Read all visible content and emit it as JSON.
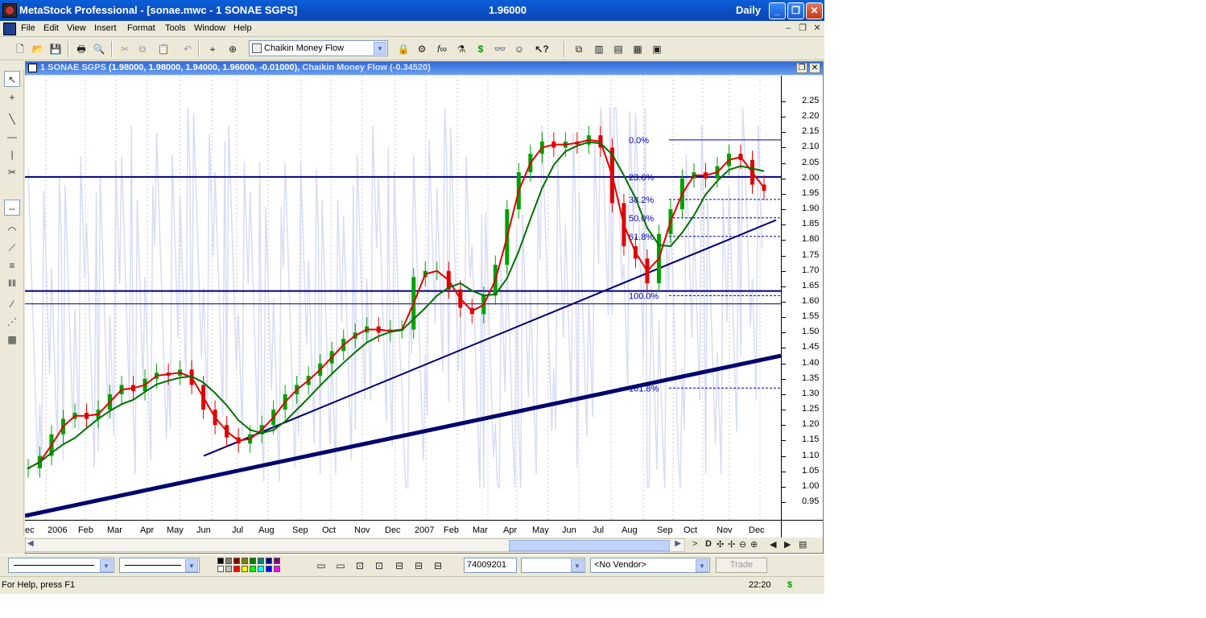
{
  "window": {
    "title": "MetaStock Professional - [sonae.mwc - 1 SONAE SGPS]",
    "price": "1.96000",
    "period": "Daily"
  },
  "menu": [
    "File",
    "Edit",
    "View",
    "Insert",
    "Format",
    "Tools",
    "Window",
    "Help"
  ],
  "toolbar": {
    "indicator_select": "Chaikin Money Flow",
    "icons": [
      "new-icon",
      "open-icon",
      "save-icon",
      "print-icon",
      "print-preview-icon",
      "cut-icon",
      "copy-icon",
      "paste-icon",
      "undo-icon",
      "crosshair-icon",
      "zoom-icon",
      "dollar-icon",
      "binoculars-icon",
      "help-cursor-icon"
    ]
  },
  "chart_window": {
    "security": "1 SONAE SGPS",
    "ohlc": "(1.98000, 1.98000, 1.94000, 1.96000, -0.01000),",
    "indicator": "Chaikin Money Flow (-0.34520)"
  },
  "chart_data": {
    "type": "candlestick",
    "ylim": [
      0.9,
      2.3
    ],
    "y_ticks": [
      "2.25",
      "2.20",
      "2.15",
      "2.10",
      "2.05",
      "2.00",
      "1.95",
      "1.90",
      "1.85",
      "1.80",
      "1.75",
      "1.70",
      "1.65",
      "1.60",
      "1.55",
      "1.50",
      "1.45",
      "1.40",
      "1.35",
      "1.30",
      "1.25",
      "1.20",
      "1.15",
      "1.10",
      "1.05",
      "1.00",
      "0.95"
    ],
    "x_labels": [
      "ec",
      "2006",
      "Feb",
      "Mar",
      "Apr",
      "May",
      "Jun",
      "Jul",
      "Aug",
      "Sep",
      "Oct",
      "Nov",
      "Dec",
      "2007",
      "Feb",
      "Mar",
      "Apr",
      "May",
      "Jun",
      "Jul",
      "Aug",
      "Sep",
      "Oct",
      "Nov",
      "Dec"
    ],
    "close": [
      1.06,
      1.1,
      1.17,
      1.22,
      1.24,
      1.22,
      1.25,
      1.3,
      1.33,
      1.31,
      1.35,
      1.37,
      1.36,
      1.38,
      1.33,
      1.25,
      1.2,
      1.16,
      1.14,
      1.17,
      1.2,
      1.25,
      1.3,
      1.33,
      1.36,
      1.4,
      1.44,
      1.48,
      1.5,
      1.52,
      1.5,
      1.51,
      1.51,
      1.68,
      1.7,
      1.7,
      1.64,
      1.58,
      1.56,
      1.62,
      1.72,
      1.9,
      2.02,
      2.08,
      2.12,
      2.1,
      2.12,
      2.11,
      2.14,
      2.1,
      1.92,
      1.78,
      1.74,
      1.66,
      1.82,
      1.9,
      2.0,
      2.02,
      2.0,
      2.04,
      2.08,
      2.06,
      1.98,
      1.96
    ],
    "fib_levels": [
      {
        "label": "0.0%",
        "value": 2.125
      },
      {
        "label": "23.6%",
        "value": 2.005
      },
      {
        "label": "38.2%",
        "value": 1.932
      },
      {
        "label": "50.0%",
        "value": 1.872
      },
      {
        "label": "61.8%",
        "value": 1.812
      },
      {
        "label": "100.0%",
        "value": 1.62
      },
      {
        "label": "161.8%",
        "value": 1.32
      }
    ],
    "horizontal_lines": [
      2.005,
      1.635,
      1.593
    ],
    "colors": {
      "candle": "#00a000",
      "ma_fast": "#e00000",
      "ma_slow": "#007000",
      "trendline": "#00006e",
      "fib": "#0000b0",
      "cmf": "#d9dcf4"
    }
  },
  "bottom_toolbar": {
    "code_field": "74009201",
    "vendor_select": "<No Vendor>",
    "trade_button": "Trade"
  },
  "status": {
    "help": "For Help, press F1",
    "time": "22:20",
    "dollar": "$"
  }
}
